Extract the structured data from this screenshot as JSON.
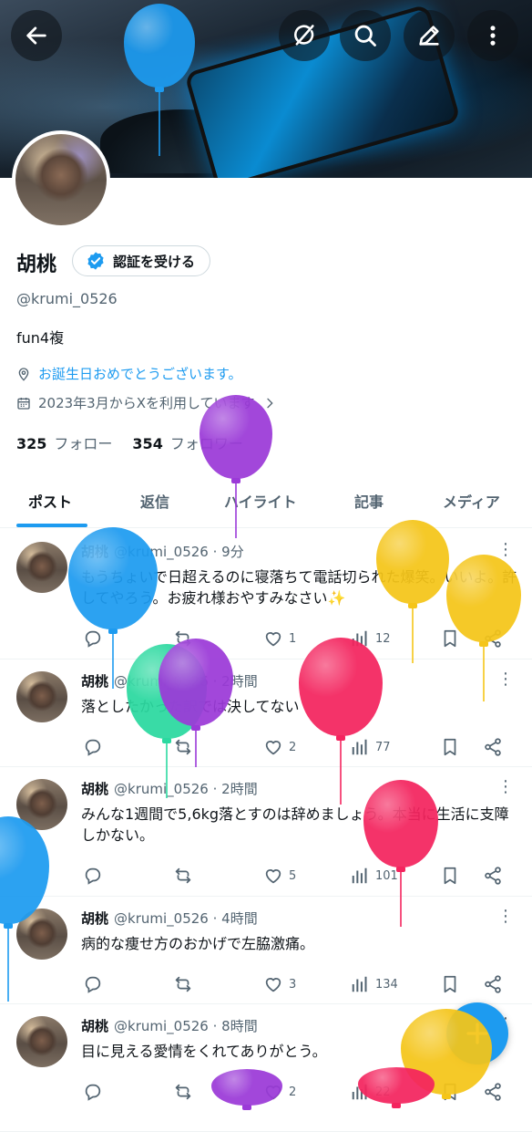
{
  "profile": {
    "name": "胡桃",
    "verify_label": "認証を受ける",
    "handle": "@krumi_0526",
    "bio": "fun4複",
    "location": "お誕生日おめでとうございます。",
    "joined": "2023年3月からXを利用しています",
    "following_count": "325",
    "following_label": "フォロー",
    "followers_count": "354",
    "followers_label": "フォロワー"
  },
  "tabs": [
    "ポスト",
    "返信",
    "ハイライト",
    "記事",
    "メディア"
  ],
  "posts": [
    {
      "name": "胡桃",
      "handle": "@krumi_0526",
      "time": "· 9分",
      "text": "もうちょいで日超えるのに寝落ちて電話切られた爆笑。いいよ。許してやろう。お疲れ様おやすみなさい✨",
      "replies": "",
      "reposts": "",
      "likes": "1",
      "views": "12"
    },
    {
      "name": "胡桃",
      "handle": "@krumi_0526",
      "time": "· 2時間",
      "text": "落としたかった訳では決してない",
      "replies": "",
      "reposts": "",
      "likes": "2",
      "views": "77"
    },
    {
      "name": "胡桃",
      "handle": "@krumi_0526",
      "time": "· 2時間",
      "text": "みんな1週間で5,6kg落とすのは辞めましょう。本当に生活に支障しかない。",
      "replies": "",
      "reposts": "",
      "likes": "5",
      "views": "101"
    },
    {
      "name": "胡桃",
      "handle": "@krumi_0526",
      "time": "· 4時間",
      "text": "病的な痩せ方のおかげで左脇激痛。",
      "replies": "",
      "reposts": "",
      "likes": "3",
      "views": "134"
    },
    {
      "name": "胡桃",
      "handle": "@krumi_0526",
      "time": "· 8時間",
      "text": "目に見える愛情をくれてありがとう。",
      "replies": "",
      "reposts": "",
      "likes": "2",
      "views": "22"
    }
  ],
  "colors": {
    "accent": "#1d9bf0",
    "text": "#0f1419",
    "muted": "#536471"
  },
  "balloon_colors": [
    "#1d9bf0",
    "#9b3ad8",
    "#f5c518",
    "#f4245e",
    "#2bd9a0"
  ]
}
